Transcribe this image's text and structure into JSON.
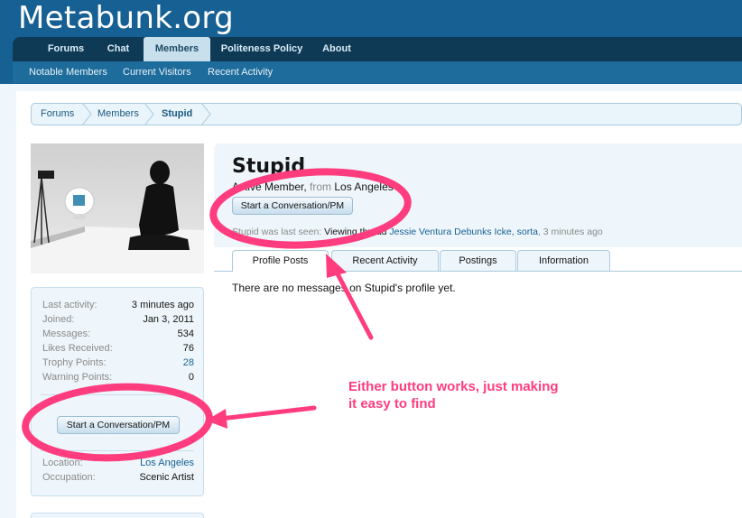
{
  "site": {
    "title": "Metabunk.org"
  },
  "nav": {
    "tabs": [
      {
        "label": "Forums"
      },
      {
        "label": "Chat"
      },
      {
        "label": "Members"
      },
      {
        "label": "Politeness Policy"
      },
      {
        "label": "About"
      }
    ],
    "active_tab": "Members",
    "subtabs": [
      {
        "label": "Notable Members"
      },
      {
        "label": "Current Visitors"
      },
      {
        "label": "Recent Activity"
      }
    ]
  },
  "breadcrumb": [
    "Forums",
    "Members",
    "Stupid"
  ],
  "sidebar": {
    "stats": [
      {
        "label": "Last activity:",
        "value": "3 minutes ago"
      },
      {
        "label": "Joined:",
        "value": "Jan 3, 2011"
      },
      {
        "label": "Messages:",
        "value": "534"
      },
      {
        "label": "Likes Received:",
        "value": "76"
      },
      {
        "label": "Trophy Points:",
        "value": "28"
      },
      {
        "label": "Warning Points:",
        "value": "0"
      }
    ],
    "conversation_button": "Start a Conversation/PM",
    "details": [
      {
        "label": "Location:",
        "value": "Los Angeles"
      },
      {
        "label": "Occupation:",
        "value": "Scenic Artist"
      }
    ]
  },
  "profile": {
    "username": "Stupid",
    "title": "Active Member",
    "from_label": "from",
    "location": "Los Angeles",
    "conversation_button": "Start a Conversation/PM",
    "last_seen_label": "Stupid was last seen:",
    "last_seen_action": "Viewing thread",
    "last_seen_thread": "Jessie Ventura Debunks Icke, sorta",
    "last_seen_time": "3 minutes ago",
    "tabs": [
      {
        "label": "Profile Posts"
      },
      {
        "label": "Recent Activity"
      },
      {
        "label": "Postings"
      },
      {
        "label": "Information"
      }
    ],
    "active_tab": "Profile Posts",
    "empty_message": "There are no messages on Stupid's profile yet."
  },
  "annotation": {
    "line1": "Either button works, just making",
    "line2": "it easy to find"
  },
  "colors": {
    "header": "#176093",
    "navbar": "#0f3a55",
    "link": "#176093",
    "annotation": "#ff3c7e"
  }
}
